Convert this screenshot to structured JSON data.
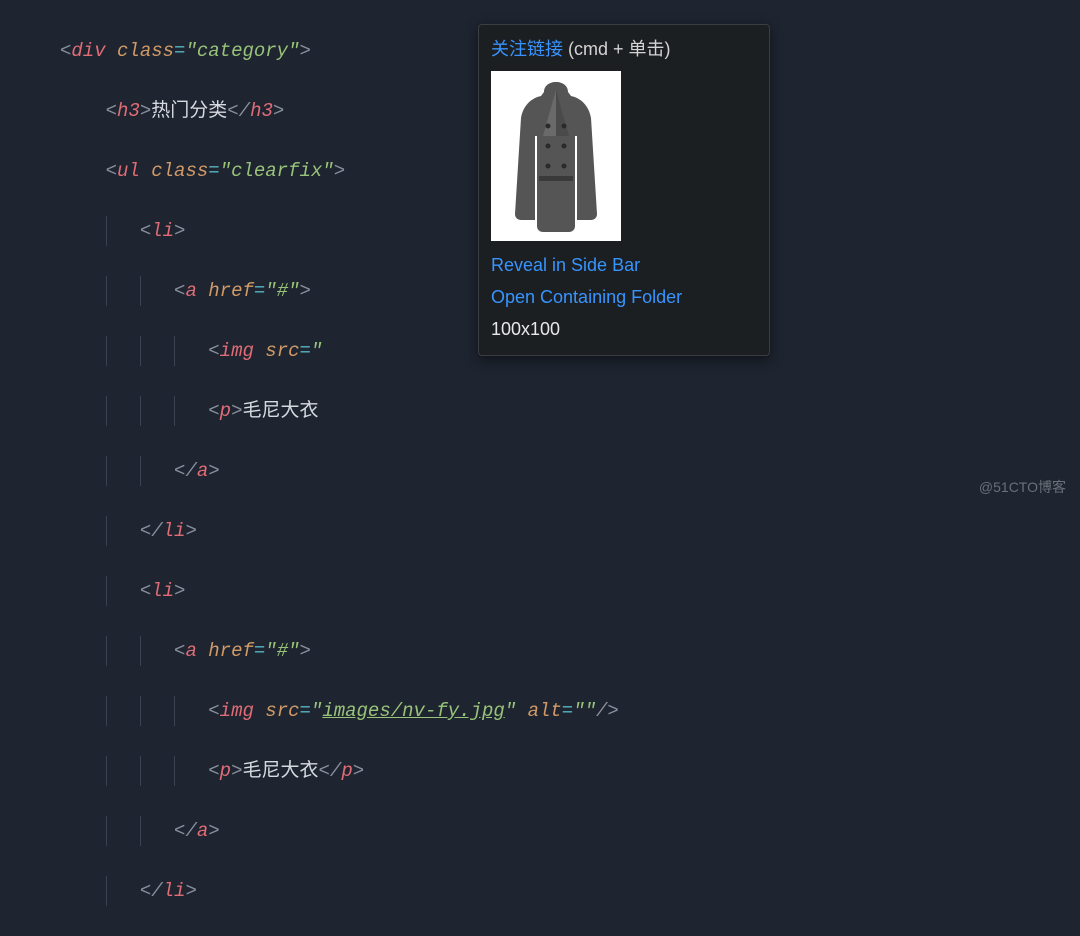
{
  "code": {
    "div_class": "category",
    "h3_text": "热门分类",
    "ul_class": "clearfix",
    "a_href": "#",
    "img_alt": "",
    "p_text": "毛尼大衣",
    "img2_src": "images/nv-fy.jpg",
    "img2_alt": "",
    "p2_text": "毛尼大衣"
  },
  "hover": {
    "follow_link": "关注链接",
    "follow_hint": " (cmd + 单击)",
    "reveal": "Reveal in Side Bar",
    "open_folder": "Open Containing Folder",
    "dimensions": "100x100"
  },
  "watermark": "@51CTO博客"
}
